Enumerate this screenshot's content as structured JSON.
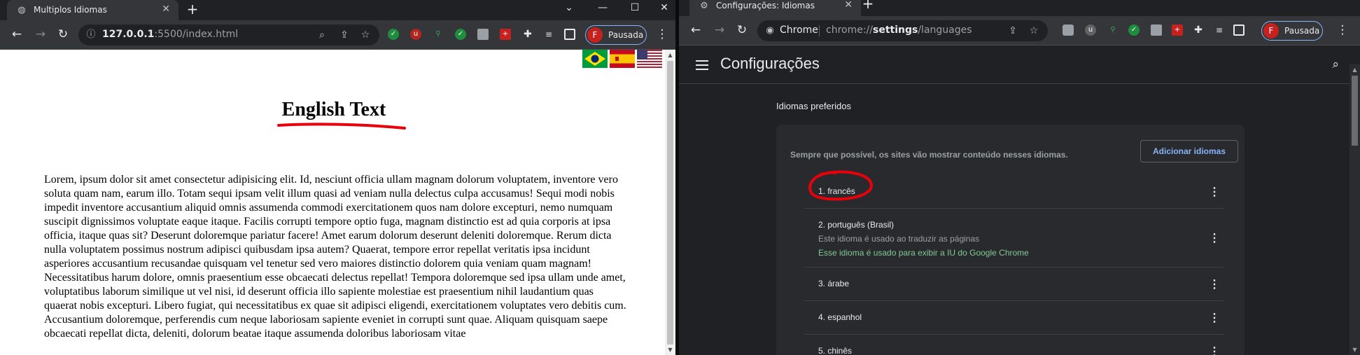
{
  "left_window": {
    "tab_title": "Multiplos Idiomas",
    "url_host": "127.0.0.1",
    "url_rest": ":5500/index.html",
    "profile_initial": "F",
    "profile_label": "Pausada",
    "page": {
      "heading": "English Text",
      "flags": [
        "brazil-flag",
        "spain-flag",
        "usa-flag"
      ],
      "paragraph": "Lorem, ipsum dolor sit amet consectetur adipisicing elit. Id, nesciunt officia ullam magnam dolorum voluptatem, inventore vero soluta quam nam, earum illo. Totam sequi ipsam velit illum quasi ad veniam nulla delectus culpa accusamus! Sequi modi nobis impedit inventore accusantium aliquid omnis assumenda commodi exercitationem quos nam dolore excepturi, nemo numquam suscipit dignissimos voluptate eaque itaque. Facilis corrupti tempore optio fuga, magnam distinctio est ad quia corporis at ipsa officia, itaque quas sit? Deserunt doloremque pariatur facere! Amet earum dolorum deserunt deleniti doloremque. Rerum dicta nulla voluptatem possimus nostrum adipisci quibusdam ipsa autem? Quaerat, tempore error repellat veritatis ipsa incidunt asperiores accusantium recusandae quisquam vel tenetur sed vero maiores distinctio dolorem quia veniam quam magnam! Necessitatibus harum dolore, omnis praesentium esse obcaecati delectus repellat! Tempora doloremque sed ipsa ullam unde amet, voluptatibus laborum similique ut vel nisi, id deserunt officia illo sapiente molestiae est praesentium nihil laudantium quas quaerat nobis excepturi. Libero fugiat, qui necessitatibus ex quae sit adipisci eligendi, exercitationem voluptates vero debitis cum. Accusantium doloremque, perferendis cum neque laboriosam sapiente eveniet in corrupti sunt quae. Aliquam quisquam saepe obcaecati repellat dicta, deleniti, dolorum beatae itaque assumenda doloribus laboriosam vitae"
    }
  },
  "right_window": {
    "tab_title": "Configurações: Idiomas",
    "chip_label": "Chrome",
    "url_prefix": "chrome://",
    "url_bold": "settings",
    "url_suffix": "/languages",
    "profile_initial": "F",
    "profile_label": "Pausada",
    "page": {
      "title": "Configurações",
      "section_title": "Idiomas preferidos",
      "description": "Sempre que possível, os sites vão mostrar conteúdo nesses idiomas.",
      "add_button": "Adicionar idiomas",
      "languages": [
        {
          "name": "1. francês"
        },
        {
          "name": "2. português (Brasil)",
          "sub": "Este idioma é usado ao traduzir as páginas",
          "ui_note": "Esse idioma é usado para exibir a IU do Google Chrome"
        },
        {
          "name": "3. árabe"
        },
        {
          "name": "4. espanhol"
        },
        {
          "name": "5. chinês"
        }
      ]
    }
  },
  "colors": {
    "annotation_red": "#e8000b",
    "accent_blue": "#8ab4f8",
    "ui_note_green": "#81c995"
  }
}
